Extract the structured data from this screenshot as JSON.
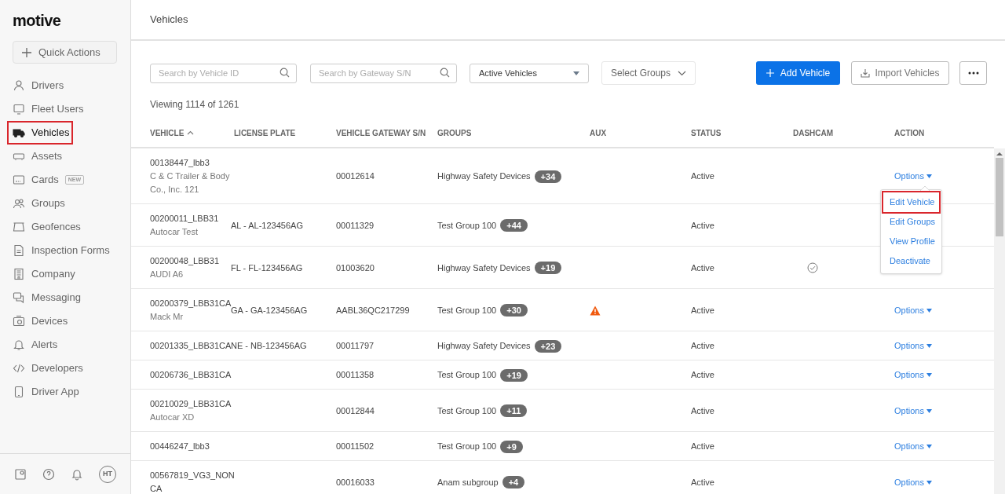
{
  "brand": "motive",
  "quick_actions": {
    "label": "Quick Actions"
  },
  "sidebar": {
    "items": [
      {
        "label": "Drivers",
        "selected": false,
        "highlighted": false
      },
      {
        "label": "Fleet Users",
        "selected": false,
        "highlighted": false
      },
      {
        "label": "Vehicles",
        "selected": true,
        "highlighted": true
      },
      {
        "label": "Assets",
        "selected": false,
        "highlighted": false
      },
      {
        "label": "Cards",
        "selected": false,
        "highlighted": false,
        "badge": "NEW"
      },
      {
        "label": "Groups",
        "selected": false,
        "highlighted": false
      },
      {
        "label": "Geofences",
        "selected": false,
        "highlighted": false
      },
      {
        "label": "Inspection Forms",
        "selected": false,
        "highlighted": false
      },
      {
        "label": "Company",
        "selected": false,
        "highlighted": false
      },
      {
        "label": "Messaging",
        "selected": false,
        "highlighted": false
      },
      {
        "label": "Devices",
        "selected": false,
        "highlighted": false
      },
      {
        "label": "Alerts",
        "selected": false,
        "highlighted": false
      },
      {
        "label": "Developers",
        "selected": false,
        "highlighted": false
      },
      {
        "label": "Driver App",
        "selected": false,
        "highlighted": false
      }
    ],
    "avatar": "HT"
  },
  "header": {
    "title": "Vehicles"
  },
  "toolbar": {
    "search_vehicle": {
      "placeholder": "Search by Vehicle ID"
    },
    "search_gateway": {
      "placeholder": "Search by Gateway S/N"
    },
    "status_filter": "Active Vehicles",
    "group_filter": "Select Groups",
    "add_button": "Add Vehicle",
    "import_button": "Import Vehicles"
  },
  "count": "Viewing 1114 of 1261",
  "table": {
    "columns": [
      "VEHICLE",
      "LICENSE PLATE",
      "VEHICLE GATEWAY S/N",
      "GROUPS",
      "AUX",
      "STATUS",
      "DASHCAM",
      "ACTION"
    ],
    "rows": [
      {
        "vehicle": "00138447_lbb3",
        "description": "C & C Trailer & Body Co., Inc. 121",
        "gateway": "00012614",
        "group": "Highway Safety Devices",
        "group_count": "+34",
        "aux_warning": false,
        "status": "Active",
        "dashcam_ok": false,
        "action": "Options"
      },
      {
        "vehicle": "00200011_LBB31",
        "description": "Autocar Test",
        "plate": "AL - AL-123456AG",
        "gateway": "00011329",
        "group": "Test Group 100",
        "group_count": "+44",
        "aux_warning": false,
        "status": "Active",
        "dashcam_ok": false
      },
      {
        "vehicle": "00200048_LBB31",
        "description": "AUDI A6",
        "plate": "FL - FL-123456AG",
        "gateway": "01003620",
        "group": "Highway Safety Devices",
        "group_count": "+19",
        "aux_warning": false,
        "status": "Active",
        "dashcam_ok": true
      },
      {
        "vehicle": "00200379_LBB31CA",
        "description": "Mack Mr",
        "plate": "GA - GA-123456AG",
        "gateway": "AABL36QC217299",
        "group": "Test Group 100",
        "group_count": "+30",
        "aux_warning": true,
        "status": "Active",
        "dashcam_ok": false,
        "action": "Options"
      },
      {
        "vehicle": "00201335_LBB31CA",
        "plate": "NE - NB-123456AG",
        "gateway": "00011797",
        "group": "Highway Safety Devices",
        "group_count": "+23",
        "aux_warning": false,
        "status": "Active",
        "dashcam_ok": false,
        "action": "Options"
      },
      {
        "vehicle": "00206736_LBB31CA",
        "gateway": "00011358",
        "group": "Test Group 100",
        "group_count": "+19",
        "aux_warning": false,
        "status": "Active",
        "dashcam_ok": false,
        "action": "Options"
      },
      {
        "vehicle": "00210029_LBB31CA",
        "description": "Autocar XD",
        "gateway": "00012844",
        "group": "Test Group 100",
        "group_count": "+11",
        "aux_warning": false,
        "status": "Active",
        "dashcam_ok": false,
        "action": "Options"
      },
      {
        "vehicle": "00446247_lbb3",
        "gateway": "00011502",
        "group": "Test Group 100",
        "group_count": "+9",
        "aux_warning": false,
        "status": "Active",
        "dashcam_ok": false,
        "action": "Options"
      },
      {
        "vehicle": "00567819_VG3_NON CA",
        "gateway": "00016033",
        "group": "Anam subgroup",
        "group_count": "+4",
        "aux_warning": false,
        "status": "Active",
        "dashcam_ok": false,
        "action": "Options"
      }
    ]
  },
  "options_menu": {
    "items": [
      {
        "label": "Edit Vehicle",
        "highlighted": true
      },
      {
        "label": "Edit Groups",
        "highlighted": false
      },
      {
        "label": "View Profile",
        "highlighted": false
      },
      {
        "label": "Deactivate",
        "highlighted": false
      }
    ]
  }
}
